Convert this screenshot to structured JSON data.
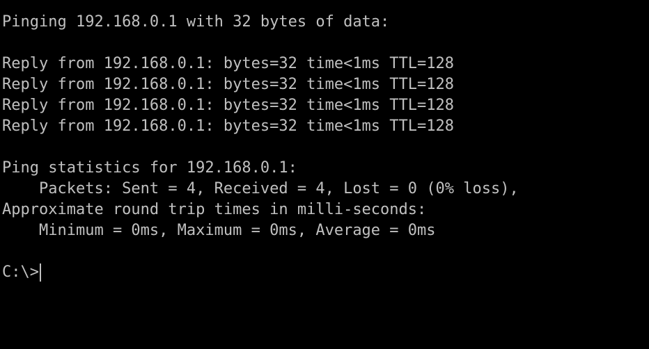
{
  "console": {
    "header": "Pinging 192.168.0.1 with 32 bytes of data:",
    "replies": [
      "Reply from 192.168.0.1: bytes=32 time<1ms TTL=128",
      "Reply from 192.168.0.1: bytes=32 time<1ms TTL=128",
      "Reply from 192.168.0.1: bytes=32 time<1ms TTL=128",
      "Reply from 192.168.0.1: bytes=32 time<1ms TTL=128"
    ],
    "stats_title": "Ping statistics for 192.168.0.1:",
    "packets": "    Packets: Sent = 4, Received = 4, Lost = 0 (0% loss),",
    "rtt_title": "Approximate round trip times in milli-seconds:",
    "rtt_values": "    Minimum = 0ms, Maximum = 0ms, Average = 0ms",
    "prompt": "C:\\>",
    "text_color": "#c0c0c0",
    "background_color": "#000000"
  }
}
